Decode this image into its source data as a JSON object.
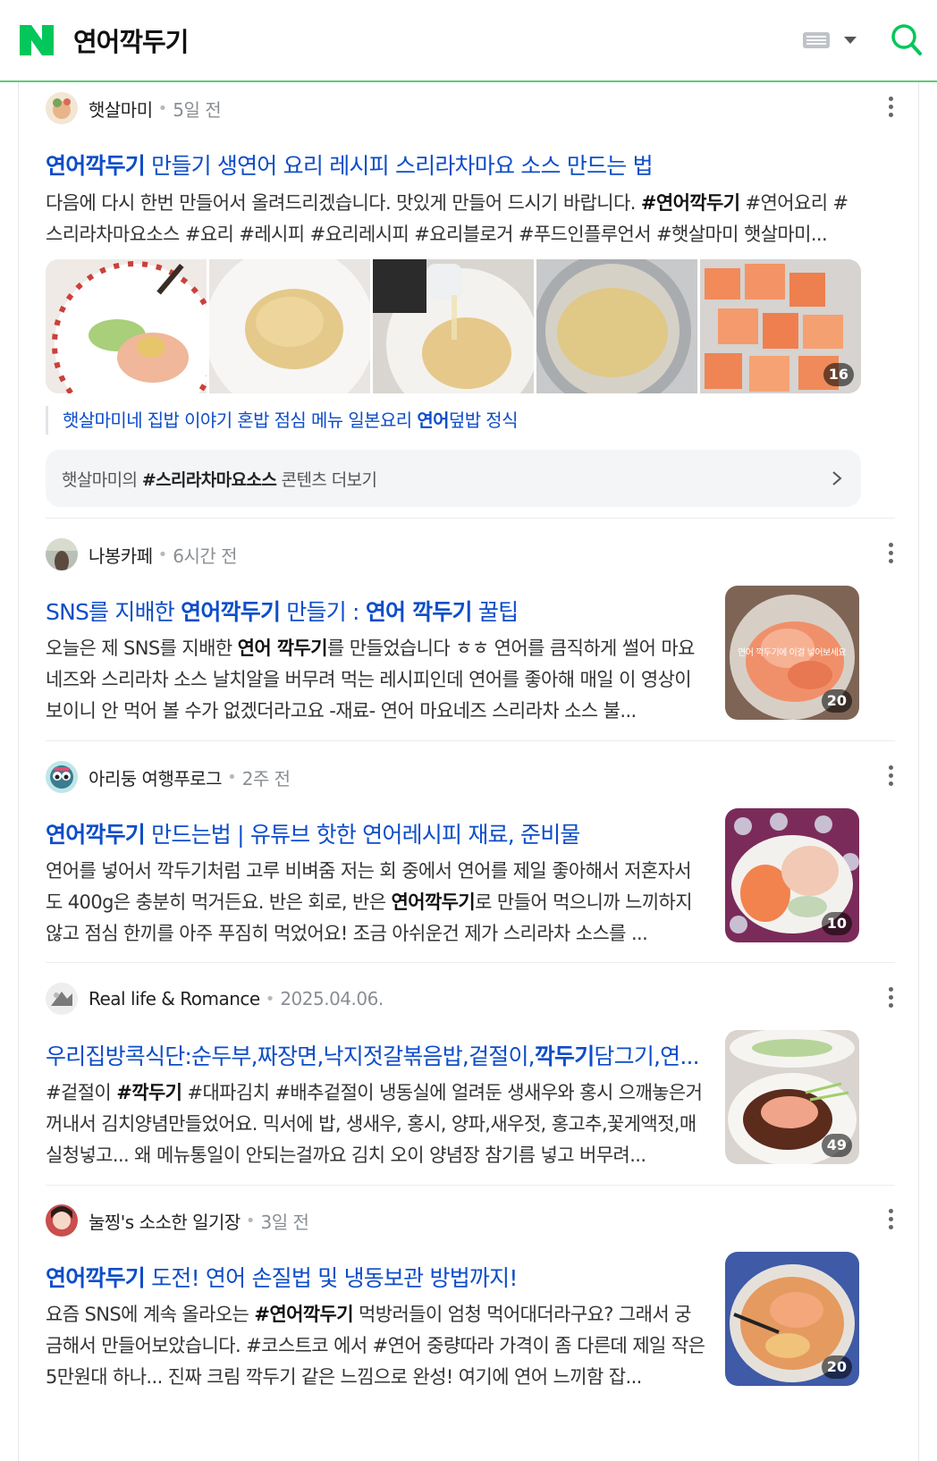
{
  "search": {
    "query": "연어깍두기"
  },
  "results": [
    {
      "author": "햇살마미",
      "date": "5일 전",
      "title_bold": "연어깍두기",
      "title_rest": " 만들기 생연어 요리 레시피 스리라차마요 소스 만드는 법",
      "desc_html": "다음에 다시 한번 만들어서 올려드리겠습니다. 맛있게 만들어 드시기 바랍니다. <b>#연어깍두기</b> #연어요리 #스리라차마요소스 #요리 #레시피 #요리레시피 #요리블로거 #푸드인플루언서 #햇살마미 햇살마미...",
      "image_count": "16",
      "sublink_pre": "햇살마미네 집밥 이야기 혼밥 점심 메뉴 일본요리 ",
      "sublink_bold": "연어",
      "sublink_post": "덮밥 정식",
      "more_pre": "햇살마미의 ",
      "more_bold": "#스리라차마요소스",
      "more_post": " 콘텐츠 더보기"
    },
    {
      "author": "나봉카페",
      "date": "6시간 전",
      "title_html": "SNS를 지배한 <b>연어깍두기</b> 만들기 : <b>연어 깍두기</b> 꿀팁",
      "desc_html": "오늘은 제 SNS를 지배한 <b>연어 깍두기</b>를 만들었습니다 ㅎㅎ 연어를 큼직하게 썰어 마요네즈와 스리라차 소스 날치알을 버무려 먹는 레시피인데 연어를 좋아해 매일 이 영상이 보이니 안 먹어 볼 수가 없겠더라고요 -재료- 연어 마요네즈 스리라차 소스 불...",
      "image_count": "20",
      "thumb_caption": "연어 깍두기에 이걸 넣어보세요"
    },
    {
      "author": "아리둥 여행푸로그",
      "date": "2주 전",
      "title_html": "<b>연어깍두기</b> 만드는법 | 유튜브 핫한 연어레시피 재료, 준비물",
      "desc_html": "연어를 넣어서 깍두기처럼 고루 비벼줌 저는 회 중에서 연어를 제일 좋아해서 저혼자서도 400g은 충분히 먹거든요. 반은 회로, 반은 <b>연어깍두기</b>로 만들어 먹으니까 느끼하지않고 점심 한끼를 아주 푸짐히 먹었어요! 조금 아쉬운건 제가 스리라차 소스를 ...",
      "image_count": "10"
    },
    {
      "author": "Real life & Romance",
      "date": "2025.04.06.",
      "title_html": "우리집방콕식단:순두부,짜장면,낙지젓갈볶음밥,겉절이,<b>깍두기</b>담그기,연...",
      "desc_html": "#겉절이 <b>#깍두기</b> #대파김치 #배추겉절이 냉동실에 얼려둔 생새우와 홍시 으깨놓은거 꺼내서 김치양념만들었어요. 믹서에 밥, 생새우, 홍시, 양파,새우젓, 홍고추,꽃게액젓,매실청넣고... 왜 메뉴통일이 안되는걸까요 김치 오이 양념장 참기름 넣고 버무려...",
      "image_count": "49"
    },
    {
      "author": "눌찡's 소소한 일기장",
      "date": "3일 전",
      "title_html": "<b>연어깍두기</b> 도전! 연어 손질법 및 냉동보관 방법까지!",
      "desc_html": "요즘 SNS에 계속 올라오는 <b>#연어깍두기</b> 먹방러들이 엄청 먹어대더라구요? 그래서 궁금해서 만들어보았습니다. #코스트코 에서 #연어 중량따라 가격이 좀 다른데 제일 작은 5만원대 하나... 진짜 크림 깍두기 같은 느낌으로 완성! 여기에 연어 느끼함 잡...",
      "image_count": "20"
    }
  ],
  "icons": {
    "logo": "naver-n-logo",
    "keyboard": "keyboard-icon",
    "search": "search-icon",
    "more": "more-vertical-icon",
    "chevron": "chevron-right-icon"
  },
  "colors": {
    "brand_green": "#03c75a",
    "title_blue": "#0e4dc8",
    "header_border": "#5ecb79"
  }
}
